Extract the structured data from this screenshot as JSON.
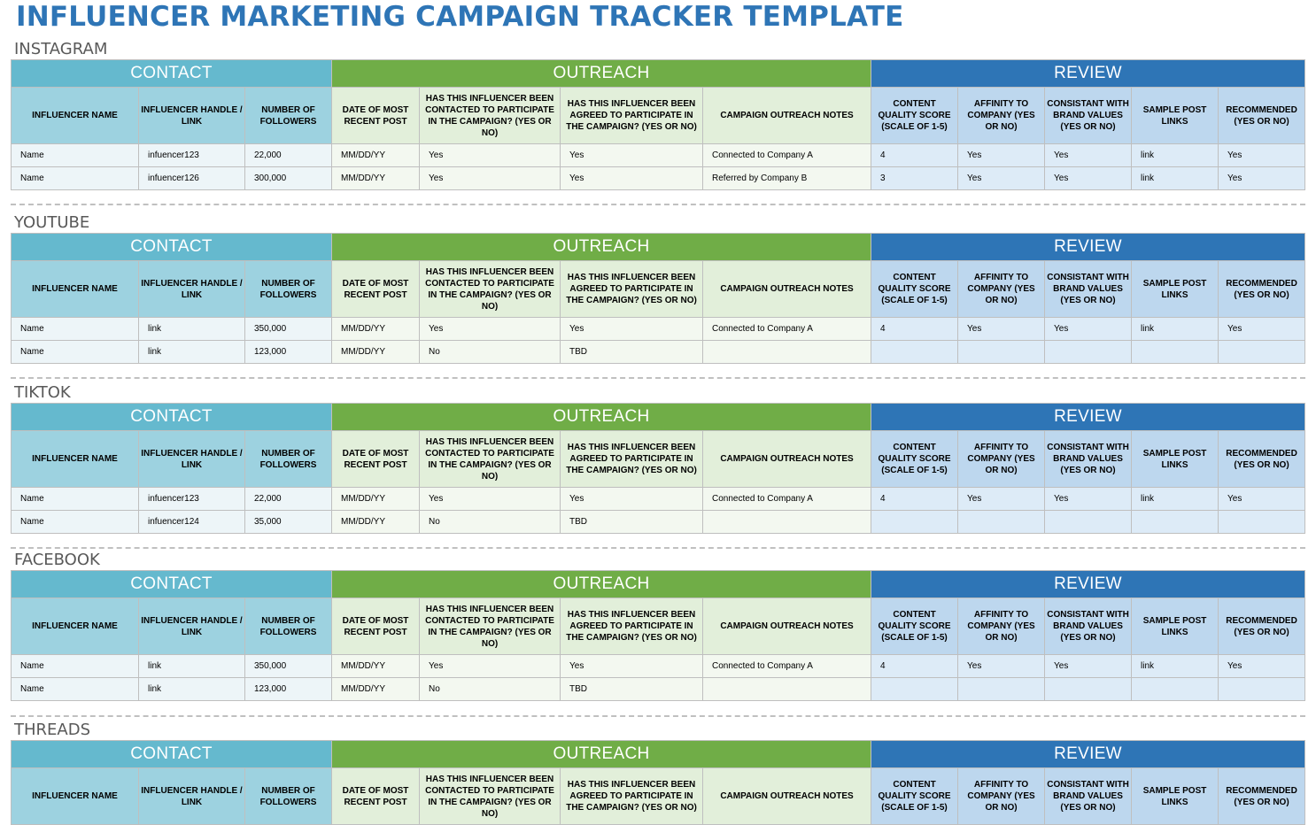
{
  "title": "INFLUENCER MARKETING CAMPAIGN TRACKER TEMPLATE",
  "groups": {
    "contact": "CONTACT",
    "outreach": "OUTREACH",
    "review": "REVIEW"
  },
  "columns": {
    "influencer_name": "INFLUENCER NAME",
    "handle": "INFLUENCER HANDLE / LINK",
    "followers": "NUMBER OF FOLLOWERS",
    "date_recent_post": "DATE OF MOST RECENT POST",
    "contacted": "HAS THIS INFLUENCER BEEN CONTACTED TO PARTICIPATE IN THE CAMPAIGN? (YES OR NO)",
    "agreed": "HAS THIS INFLUENCER BEEN AGREED TO PARTICIPATE IN THE CAMPAIGN? (YES OR NO)",
    "notes": "CAMPAIGN OUTREACH NOTES",
    "quality": "CONTENT QUALITY SCORE (SCALE OF 1-5)",
    "affinity": "AFFINITY TO COMPANY (YES OR NO)",
    "brand_values": "CONSISTANT WITH BRAND VALUES (YES OR NO)",
    "sample_links": "SAMPLE POST LINKS",
    "recommended": "RECOMMENDED (YES OR NO)"
  },
  "sections": [
    {
      "label": "INSTAGRAM",
      "rows": [
        {
          "name": "Name",
          "handle": "infuencer123",
          "followers": "22,000",
          "date": "MM/DD/YY",
          "contacted": "Yes",
          "agreed": "Yes",
          "notes": "Connected to Company A",
          "quality": "4",
          "affinity": "Yes",
          "brand_values": "Yes",
          "sample_links": "link",
          "recommended": "Yes"
        },
        {
          "name": "Name",
          "handle": "infuencer126",
          "followers": "300,000",
          "date": "MM/DD/YY",
          "contacted": "Yes",
          "agreed": "Yes",
          "notes": "Referred by Company B",
          "quality": "3",
          "affinity": "Yes",
          "brand_values": "Yes",
          "sample_links": "link",
          "recommended": "Yes"
        }
      ]
    },
    {
      "label": "YOUTUBE",
      "rows": [
        {
          "name": "Name",
          "handle": "link",
          "followers": "350,000",
          "date": "MM/DD/YY",
          "contacted": "Yes",
          "agreed": "Yes",
          "notes": "Connected to Company A",
          "quality": "4",
          "affinity": "Yes",
          "brand_values": "Yes",
          "sample_links": "link",
          "recommended": "Yes"
        },
        {
          "name": "Name",
          "handle": "link",
          "followers": "123,000",
          "date": "MM/DD/YY",
          "contacted": "No",
          "agreed": "TBD",
          "notes": "",
          "quality": "",
          "affinity": "",
          "brand_values": "",
          "sample_links": "",
          "recommended": ""
        }
      ]
    },
    {
      "label": "TIKTOK",
      "rows": [
        {
          "name": "Name",
          "handle": "infuencer123",
          "followers": "22,000",
          "date": "MM/DD/YY",
          "contacted": "Yes",
          "agreed": "Yes",
          "notes": "Connected to Company A",
          "quality": "4",
          "affinity": "Yes",
          "brand_values": "Yes",
          "sample_links": "link",
          "recommended": "Yes"
        },
        {
          "name": "Name",
          "handle": "infuencer124",
          "followers": "35,000",
          "date": "MM/DD/YY",
          "contacted": "No",
          "agreed": "TBD",
          "notes": "",
          "quality": "",
          "affinity": "",
          "brand_values": "",
          "sample_links": "",
          "recommended": ""
        }
      ]
    },
    {
      "label": "FACEBOOK",
      "rows": [
        {
          "name": "Name",
          "handle": "link",
          "followers": "350,000",
          "date": "MM/DD/YY",
          "contacted": "Yes",
          "agreed": "Yes",
          "notes": "Connected to Company A",
          "quality": "4",
          "affinity": "Yes",
          "brand_values": "Yes",
          "sample_links": "link",
          "recommended": "Yes"
        },
        {
          "name": "Name",
          "handle": "link",
          "followers": "123,000",
          "date": "MM/DD/YY",
          "contacted": "No",
          "agreed": "TBD",
          "notes": "",
          "quality": "",
          "affinity": "",
          "brand_values": "",
          "sample_links": "",
          "recommended": ""
        }
      ]
    },
    {
      "label": "THREADS",
      "rows": []
    }
  ],
  "colors": {
    "title": "#2e75b6",
    "contact_band": "#65b9ce",
    "outreach_band": "#70ad47",
    "review_band": "#2e75b6",
    "contact_header": "#9dd2e0",
    "outreach_header": "#e2efda",
    "review_header": "#bdd7ee"
  }
}
